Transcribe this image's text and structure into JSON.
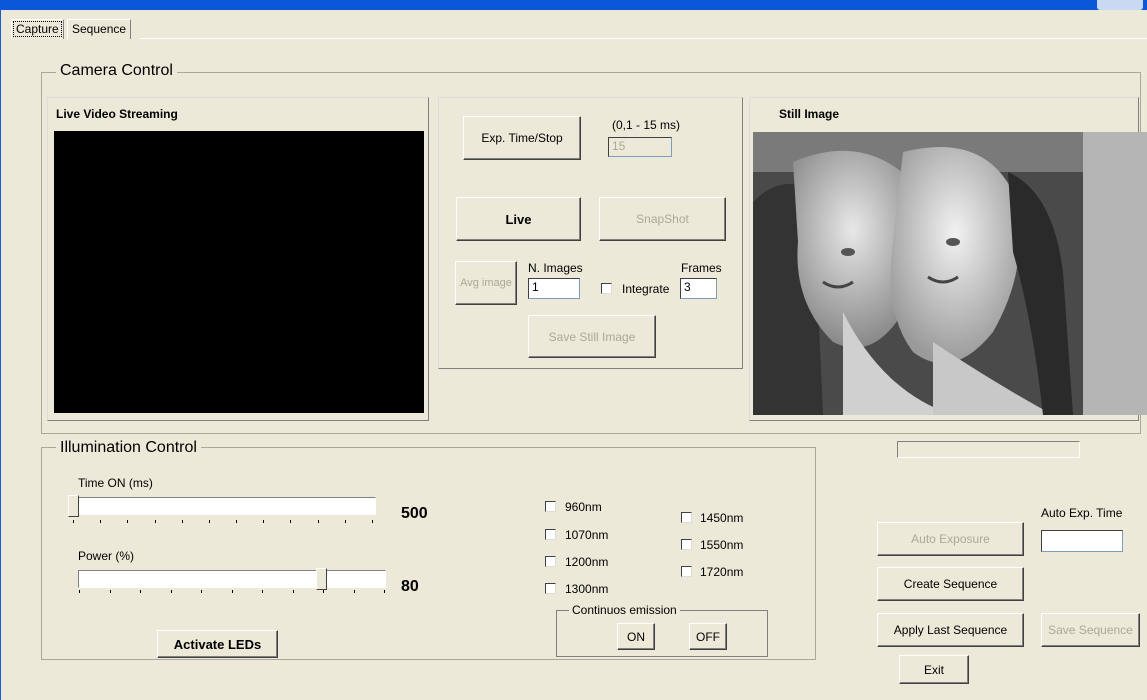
{
  "tabs": [
    {
      "label": "Capture"
    },
    {
      "label": "Sequence"
    }
  ],
  "camera": {
    "title": "Camera Control",
    "live_title": "Live Video Streaming",
    "still_title": "Still Image",
    "exp_button": "Exp. Time/Stop",
    "exp_range": "(0,1 - 15 ms)",
    "exp_value": "15",
    "live_button": "Live",
    "snapshot_button": "SnapShot",
    "avg_button": "Avg image",
    "n_images_label": "N. Images",
    "n_images_value": "1",
    "integrate_label": "Integrate",
    "frames_label": "Frames",
    "frames_value": "3",
    "save_still_button": "Save Still Image"
  },
  "illumination": {
    "title": "Illumination Control",
    "time_label": "Time ON (ms)",
    "time_value": "500",
    "power_label": "Power (%)",
    "power_value": "80",
    "activate_button": "Activate LEDs",
    "wavelengths_left": [
      "960nm",
      "1070nm",
      "1200nm",
      "1300nm"
    ],
    "wavelengths_right": [
      "1450nm",
      "1550nm",
      "1720nm"
    ],
    "continuous_title": "Continuos emission",
    "on_button": "ON",
    "off_button": "OFF"
  },
  "sequence": {
    "auto_exposure_button": "Auto Exposure",
    "auto_exp_time_label": "Auto Exp. Time",
    "auto_exp_time_value": "",
    "create_button": "Create Sequence",
    "apply_button": "Apply Last Sequence",
    "save_button": "Save Sequence",
    "exit_button": "Exit"
  },
  "colors": {
    "window_bg": "#ece9d8",
    "title_bar": "#0a57d8",
    "video_bg": "#000000"
  }
}
